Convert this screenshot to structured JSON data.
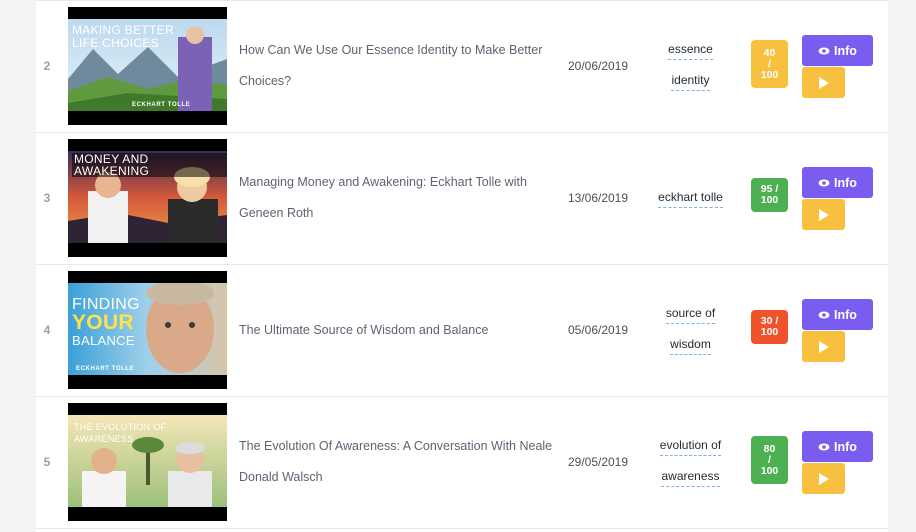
{
  "rows": [
    {
      "number": "2",
      "thumbnail": {
        "caption_line1": "MAKING BETTER",
        "caption_line2": "LIFE CHOICES",
        "brand": "ECKHART TOLLE"
      },
      "title": "How Can We Use Our Essence Identity to Make Better Choices?",
      "date": "20/06/2019",
      "tags": [
        "essence",
        "identity"
      ],
      "score": {
        "value": "40",
        "sep": "/",
        "max": "100",
        "color": "#f7c03e"
      },
      "info_label": "Info"
    },
    {
      "number": "3",
      "thumbnail": {
        "caption_line1": "MONEY AND AWAKENING",
        "caption_line2": "",
        "brand": ""
      },
      "title": "Managing Money and Awakening: Eckhart Tolle with Geneen Roth",
      "date": "13/06/2019",
      "tags": [
        "eckhart tolle"
      ],
      "score": {
        "value": "95 /",
        "sep": "",
        "max": "100",
        "color": "#4caf50"
      },
      "info_label": "Info"
    },
    {
      "number": "4",
      "thumbnail": {
        "caption_line1": "FINDING",
        "caption_line2": "YOUR",
        "caption_line3": "BALANCE",
        "brand": "ECKHART TOLLE"
      },
      "title": "The Ultimate Source of Wisdom and Balance",
      "date": "05/06/2019",
      "tags": [
        "source of",
        "wisdom"
      ],
      "score": {
        "value": "30 /",
        "sep": "",
        "max": "100",
        "color": "#f0532b"
      },
      "info_label": "Info"
    },
    {
      "number": "5",
      "thumbnail": {
        "caption_line1": "THE EVOLUTION OF AWARENESS",
        "caption_line2": "",
        "brand": ""
      },
      "title": "The Evolution Of Awareness: A Conversation With Neale Donald Walsch",
      "date": "29/05/2019",
      "tags": [
        "evolution of",
        "awareness"
      ],
      "score": {
        "value": "80",
        "sep": "/",
        "max": "100",
        "color": "#4caf50"
      },
      "info_label": "Info"
    }
  ]
}
